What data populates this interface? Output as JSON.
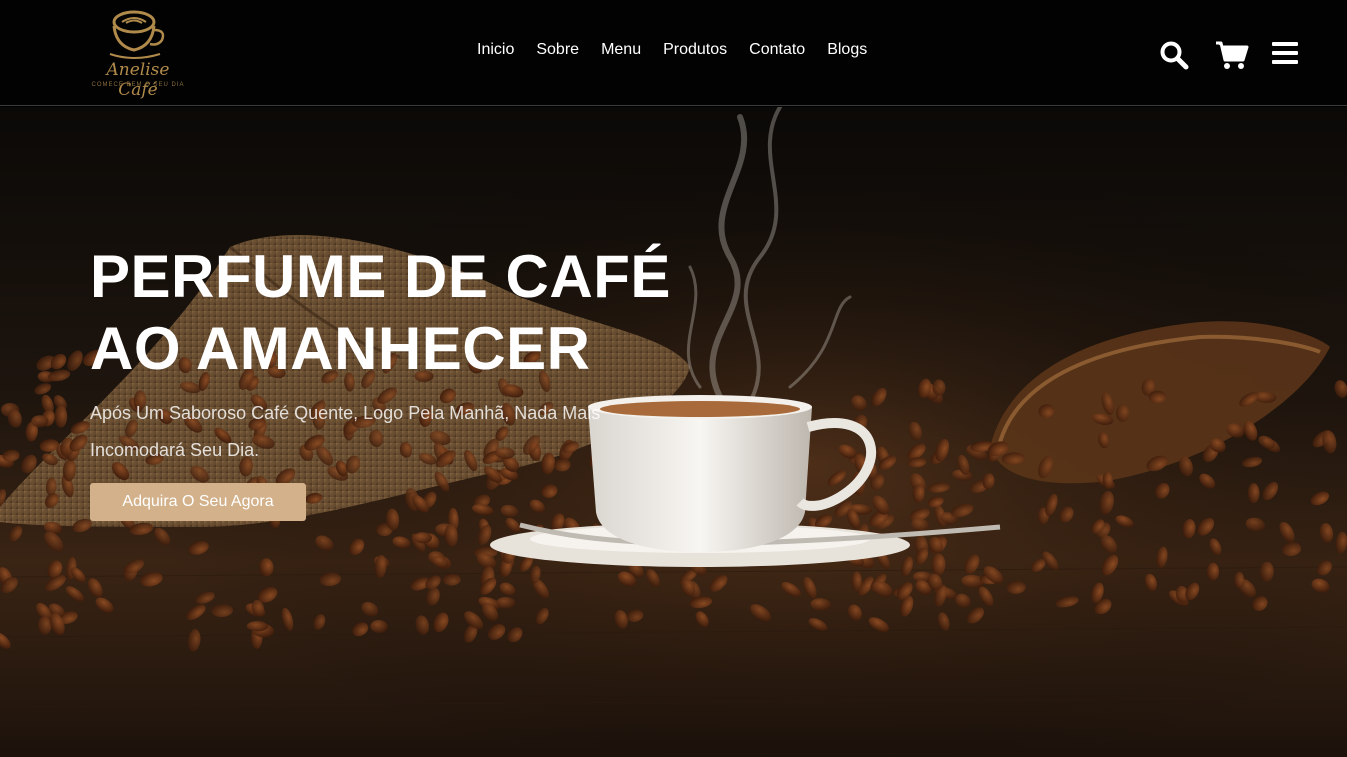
{
  "header": {
    "logo": {
      "brand": "Anelise Café",
      "tagline": "COMECE BEM O SEU DIA",
      "icon": "coffee-cup-logo"
    },
    "nav": [
      "Inicio",
      "Sobre",
      "Menu",
      "Produtos",
      "Contato",
      "Blogs"
    ],
    "icons": [
      "search-icon",
      "cart-icon",
      "menu-icon"
    ]
  },
  "hero": {
    "title_line1": "PERFUME DE CAFÉ",
    "title_line2": "AO AMANHECER",
    "subtitle": "Após Um Saboroso Café Quente, Logo Pela Manhã, Nada Mais Incomodará Seu Dia.",
    "button": "Adquira O Seu Agora"
  },
  "colors": {
    "header_bg": "#020203",
    "accent": "#d3b18a",
    "logo_gold": "#b08a4a"
  }
}
